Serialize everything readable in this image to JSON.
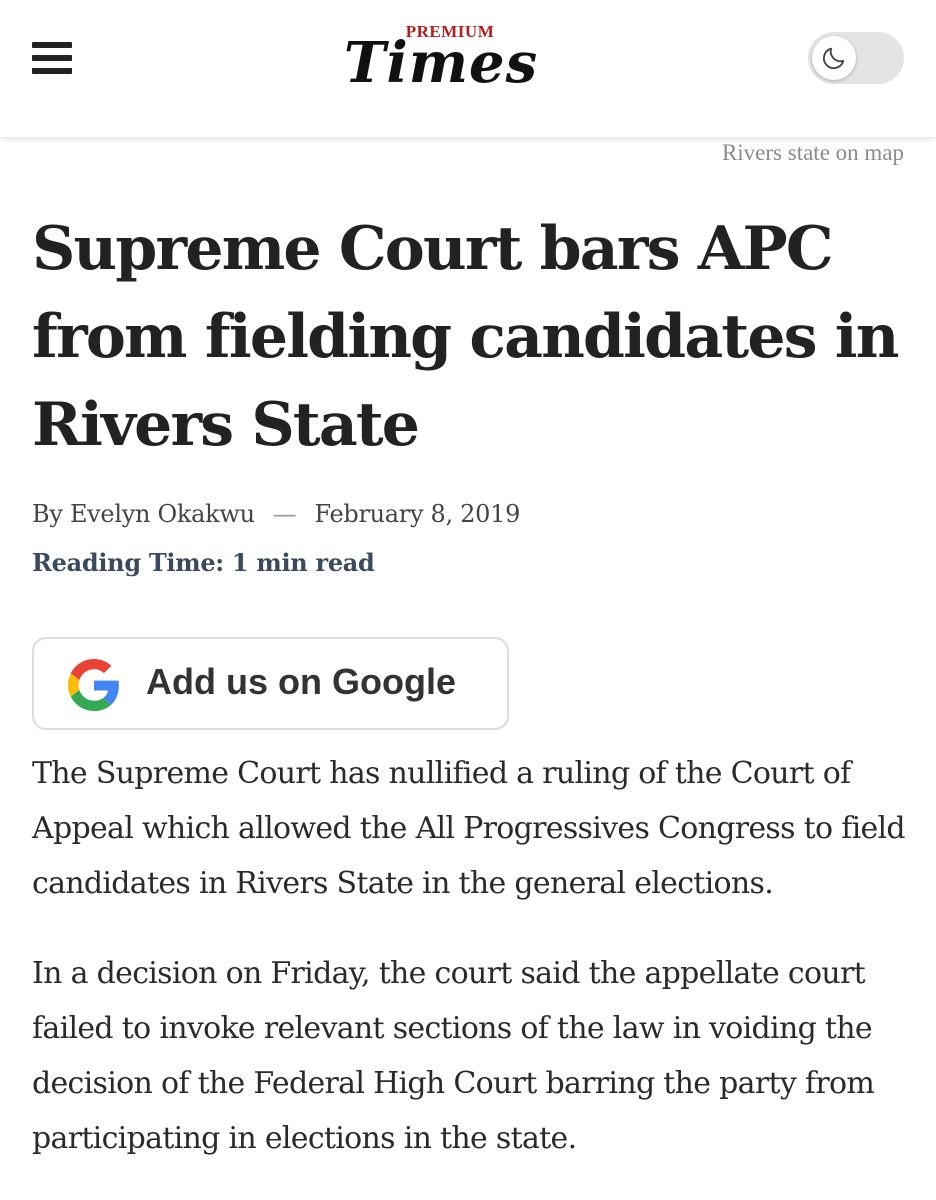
{
  "header": {
    "menu_icon": "hamburger-menu-icon",
    "logo": {
      "top_text": "PREMIUM",
      "main_text": "Times"
    },
    "dark_mode_icon": "moon-icon"
  },
  "article": {
    "image_caption": "Rivers state on map",
    "headline": "Supreme Court bars APC from fielding candidates in Rivers State",
    "byline": {
      "prefix": "By",
      "author": "Evelyn Okakwu",
      "separator": "—",
      "date": "February 8, 2019"
    },
    "reading_time": "Reading Time: 1 min read",
    "google_button": {
      "label": "Add us on Google",
      "icon": "google-g-icon"
    },
    "paragraphs": [
      "The Supreme Court has nullified a ruling of the Court of Appeal which allowed the All Progressives Congress to field candidates in Rivers State in the general elections.",
      "In a decision on Friday, the court said the appellate court failed to invoke relevant sections of the law in voiding the decision of the Federal High Court barring the party from participating in elections in the state."
    ]
  },
  "colors": {
    "text": "#222222",
    "reading_time": "#3a4a5e",
    "caption": "#8a8a8a",
    "logo_accent": "#b71c1c"
  }
}
